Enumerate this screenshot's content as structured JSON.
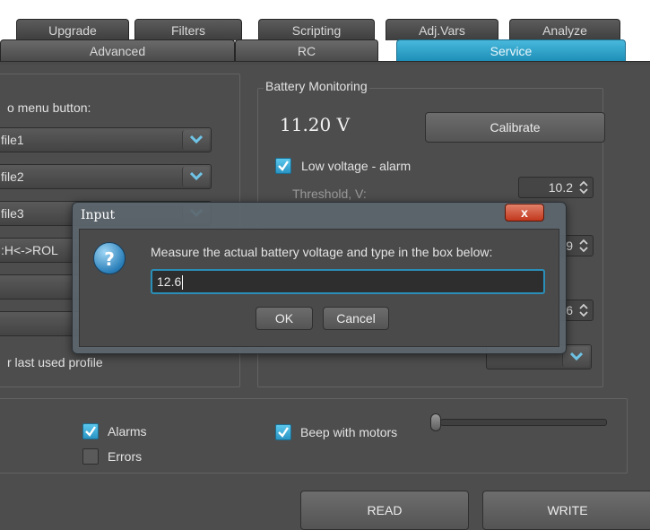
{
  "tabs_back": [
    {
      "label": "Upgrade"
    },
    {
      "label": "Filters"
    },
    {
      "label": "Scripting"
    },
    {
      "label": "Adj.Vars"
    },
    {
      "label": "Analyze"
    }
  ],
  "tabs_front": [
    {
      "label": "Advanced"
    },
    {
      "label": "RC"
    },
    {
      "label": "Service"
    }
  ],
  "active_tab": "Service",
  "left_panel": {
    "menu_button_label": "o menu button:",
    "combos": [
      "file1",
      "file2",
      "file3",
      ":H<->ROL",
      "",
      ""
    ],
    "last_used_label": "r last used profile"
  },
  "battery": {
    "group_title": "Battery Monitoring",
    "voltage": "11.20 V",
    "calibrate_label": "Calibrate",
    "low_voltage_label": "Low voltage - alarm",
    "low_voltage_checked": true,
    "threshold_label": "Threshold, V:",
    "threshold_value": "10.2",
    "spin2_value": "9",
    "spin3_value": "6"
  },
  "bottom": {
    "alarms_label": "Alarms",
    "alarms_checked": true,
    "errors_label": "Errors",
    "errors_checked": false,
    "beep_label": "Beep with motors",
    "beep_checked": true,
    "beep_level_percent": 0
  },
  "footer": {
    "read_label": "READ",
    "write_label": "WRITE"
  },
  "dialog": {
    "title": "Input",
    "close_glyph": "x",
    "message": "Measure the actual battery voltage and type in the box below:",
    "input_value": "12.6",
    "ok_label": "OK",
    "cancel_label": "Cancel",
    "icon_glyph": "?"
  },
  "colors": {
    "accent": "#2a95c4",
    "panel": "#4d4d4d",
    "close_red": "#c2381d"
  }
}
